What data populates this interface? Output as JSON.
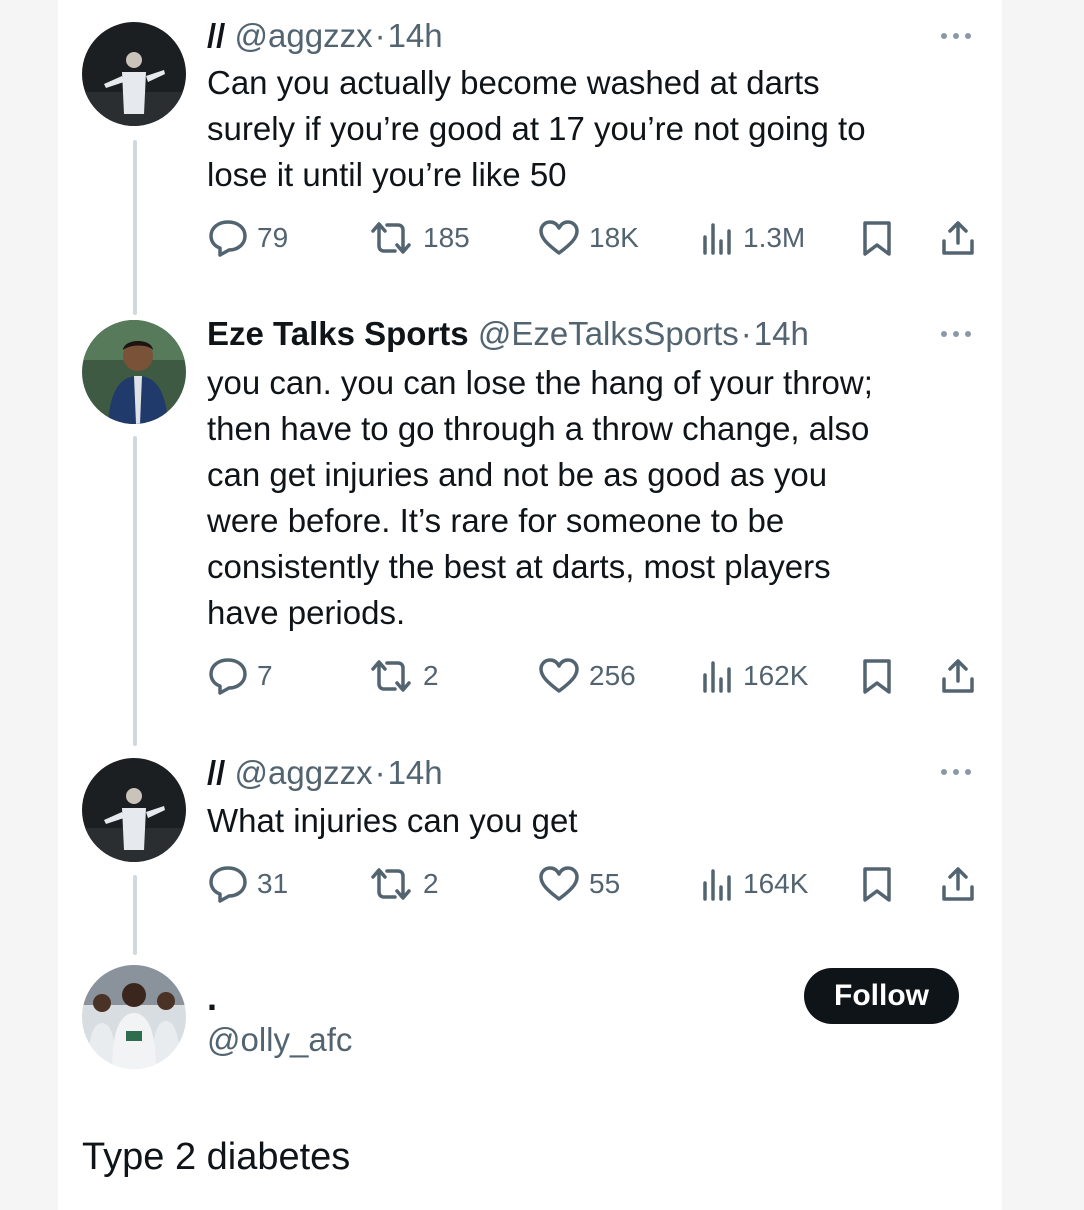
{
  "tweets": [
    {
      "name": "//",
      "handle": "@aggzzx",
      "separator": "·",
      "time": "14h",
      "text_lines": [
        "Can you actually become washed at darts",
        "surely if you’re good at 17 you’re not going to",
        "lose it until you’re like 50"
      ],
      "stats": {
        "replies": "79",
        "retweets": "185",
        "likes": "18K",
        "views": "1.3M"
      }
    },
    {
      "name": "Eze Talks Sports",
      "handle": "@EzeTalksSports",
      "separator": "·",
      "time": "14h",
      "text_lines": [
        "you can. you can lose the hang of your throw;",
        "then have to go through a throw change, also",
        "can get injuries and not be as good as you",
        "were before. It’s rare for someone to be",
        "consistently the best at darts, most players",
        "have periods."
      ],
      "stats": {
        "replies": "7",
        "retweets": "2",
        "likes": "256",
        "views": "162K"
      }
    },
    {
      "name": "//",
      "handle": "@aggzzx",
      "separator": "·",
      "time": "14h",
      "text_lines": [
        "What injuries can you get"
      ],
      "stats": {
        "replies": "31",
        "retweets": "2",
        "likes": "55",
        "views": "164K"
      }
    }
  ],
  "final_tweet": {
    "name": ".",
    "handle": "@olly_afc",
    "follow_label": "Follow",
    "text": "Type 2 diabetes"
  },
  "icons": {
    "reply": "reply-icon",
    "retweet": "retweet-icon",
    "like": "heart-icon",
    "views": "views-icon",
    "bookmark": "bookmark-icon",
    "share": "share-icon",
    "more": "more-icon"
  },
  "colors": {
    "text": "#0f1419",
    "secondary": "#536471",
    "thread_line": "#cfd9de",
    "follow_bg": "#0f1419"
  }
}
